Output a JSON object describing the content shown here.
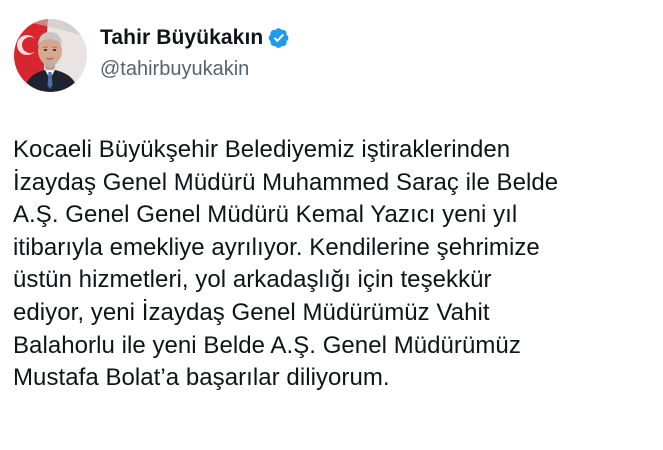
{
  "tweet": {
    "author": {
      "display_name": "Tahir Büyükakın",
      "handle": "@tahirbuyukakin",
      "verified": true,
      "avatar_icon": "profile-photo",
      "verified_icon": "verified-badge-icon"
    },
    "text": "Kocaeli Büyükşehir Belediyemiz iştiraklerinden\nİzaydaş Genel Müdürü Muhammed Saraç ile Belde\nA.Ş. Genel Genel Müdürü Kemal Yazıcı yeni yıl\nitibarıyla emekliye ayrılıyor. Kendilerine şehrimize\nüstün hizmetleri, yol arkadaşlığı için teşekkür\nediyor, yeni İzaydaş Genel Müdürümüz Vahit\nBalahorlu ile yeni Belde A.Ş. Genel Müdürümüz\nMustafa Bolat’a başarılar diliyorum."
  },
  "colors": {
    "text_primary": "#0f1419",
    "text_secondary": "#536471",
    "verified_blue": "#1d9bf0",
    "background": "#ffffff"
  }
}
